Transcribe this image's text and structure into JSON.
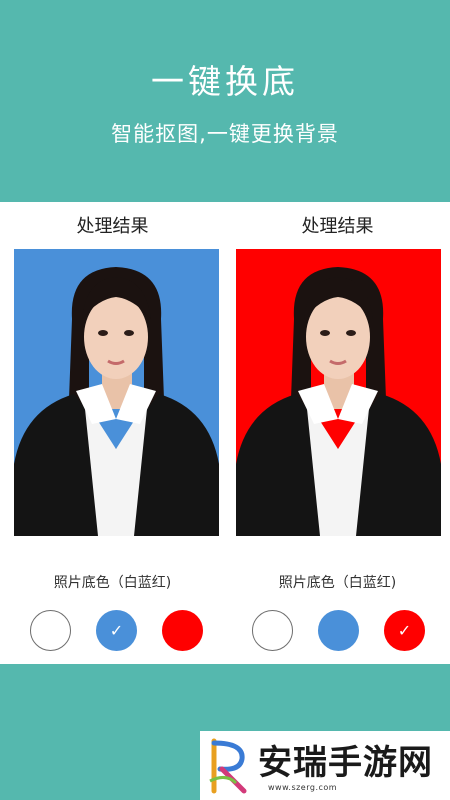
{
  "hero": {
    "title": "一键换底",
    "subtitle": "智能抠图,一键更换背景"
  },
  "columns": [
    {
      "title": "处理结果",
      "background_color": "#4a90d9",
      "caption": "照片底色（白蓝红)",
      "selected": "blue"
    },
    {
      "title": "处理结果",
      "background_color": "#ff0000",
      "caption": "照片底色（白蓝红)",
      "selected": "red"
    }
  ],
  "swatch_colors": {
    "white": "#ffffff",
    "blue": "#4a90d9",
    "red": "#ff0000"
  },
  "check_glyph": "✓",
  "accent_color": "#55b8ae",
  "watermark": {
    "name": "安瑞手游网",
    "url": "www.szerg.com"
  }
}
